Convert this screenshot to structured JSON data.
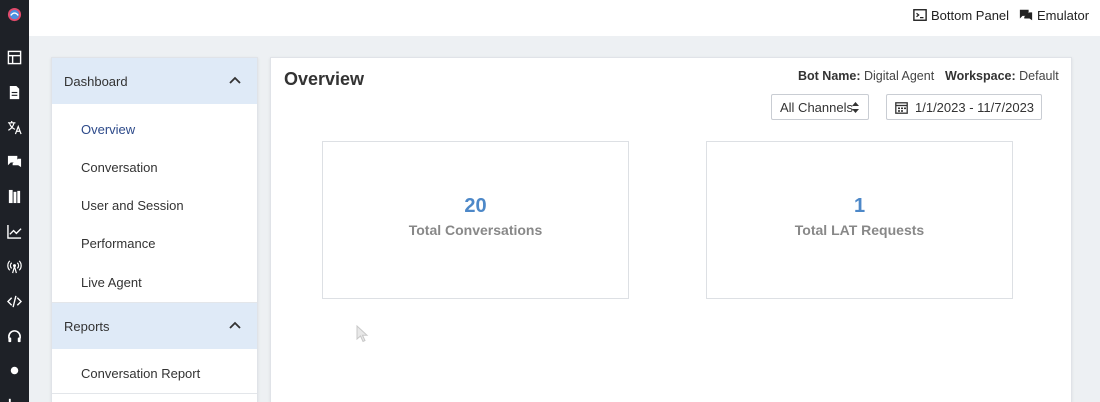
{
  "header": {
    "bottom_panel_label": "Bottom Panel",
    "emulator_label": "Emulator"
  },
  "rail_icons": [
    "logo-icon",
    "layout-icon",
    "document-icon",
    "translate-icon",
    "chat-icon",
    "library-icon",
    "chart-icon",
    "broadcast-icon",
    "code-icon",
    "headset-icon",
    "dot-icon",
    "more-icon"
  ],
  "sidebar": {
    "sections": [
      {
        "title": "Dashboard",
        "items": [
          "Overview",
          "Conversation",
          "User and Session",
          "Performance",
          "Live Agent"
        ]
      },
      {
        "title": "Reports",
        "items": [
          "Conversation Report"
        ]
      }
    ],
    "active_item": "Overview"
  },
  "main": {
    "title": "Overview",
    "bot_name_label": "Bot Name:",
    "bot_name_value": "Digital Agent",
    "workspace_label": "Workspace:",
    "workspace_value": "Default",
    "channel_select": "All Channels",
    "date_range": "1/1/2023 - 11/7/2023",
    "stats": [
      {
        "value": "20",
        "label": "Total Conversations"
      },
      {
        "value": "1",
        "label": "Total LAT Requests"
      }
    ]
  },
  "colors": {
    "rail_bg": "#1e2127",
    "section_header_bg": "#dfeaf7",
    "stat_number": "#4d88c8",
    "active_nav": "#2d4a8a"
  }
}
